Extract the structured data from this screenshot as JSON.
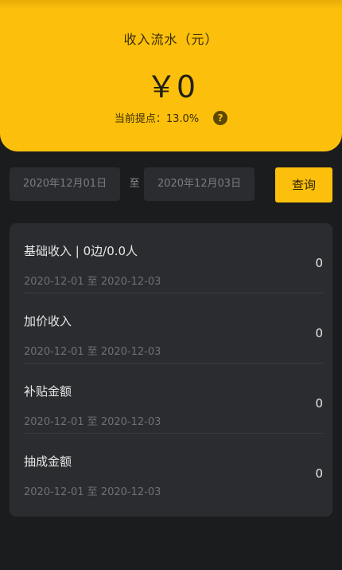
{
  "header": {
    "title": "收入流水（元）",
    "amount": "￥0",
    "rate_label": "当前提点：13.0%",
    "help_icon": "question-circle-icon"
  },
  "filter": {
    "start_date": "2020年12月01日",
    "separator": "至",
    "end_date": "2020年12月03日",
    "query_label": "查询"
  },
  "items": [
    {
      "label": "基础收入 | 0边/0.0人",
      "date_range": "2020-12-01 至 2020-12-03",
      "value": "0"
    },
    {
      "label": "加价收入",
      "date_range": "2020-12-01 至 2020-12-03",
      "value": "0"
    },
    {
      "label": "补贴金额",
      "date_range": "2020-12-01 至 2020-12-03",
      "value": "0"
    },
    {
      "label": "抽成金额",
      "date_range": "2020-12-01 至 2020-12-03",
      "value": "0"
    }
  ],
  "colors": {
    "accent": "#fcc00c",
    "background": "#1b1c1e",
    "card": "#2b2c2f"
  }
}
